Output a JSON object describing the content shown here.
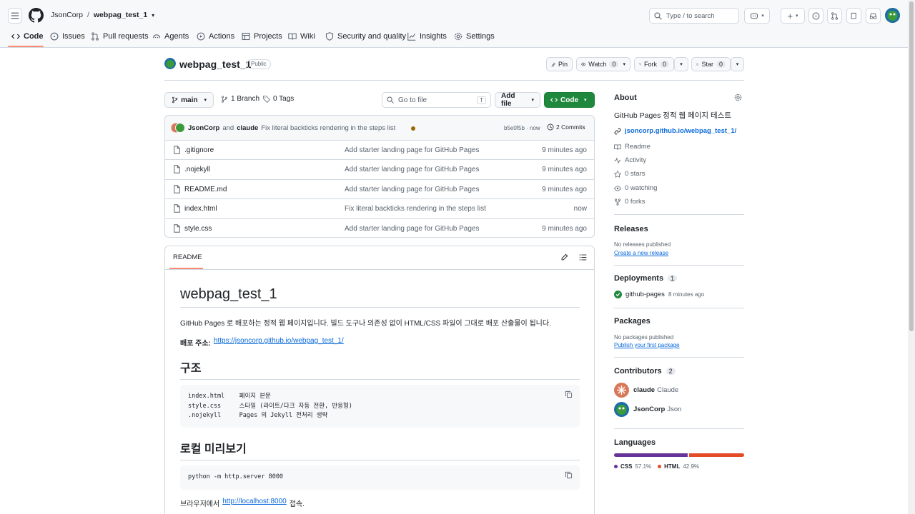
{
  "header": {
    "owner": "JsonCorp",
    "separator": "/",
    "repo": "webpag_test_1",
    "search_placeholder": "Type / to search",
    "search_key": "/"
  },
  "tabs": [
    {
      "label": "Code"
    },
    {
      "label": "Issues"
    },
    {
      "label": "Pull requests"
    },
    {
      "label": "Agents"
    },
    {
      "label": "Actions"
    },
    {
      "label": "Projects"
    },
    {
      "label": "Wiki"
    },
    {
      "label": "Security and quality"
    },
    {
      "label": "Insights"
    },
    {
      "label": "Settings"
    }
  ],
  "repo": {
    "name": "webpag_test_1",
    "visibility": "Public",
    "pin": "Pin",
    "watch": "Watch",
    "watch_count": "0",
    "fork": "Fork",
    "fork_count": "0",
    "star": "Star",
    "star_count": "0"
  },
  "toolbar": {
    "branch": "main",
    "branches": "1 Branch",
    "tags": "0 Tags",
    "goto_placeholder": "Go to file",
    "goto_key": "T",
    "add_file": "Add file",
    "code": "Code"
  },
  "commit": {
    "author1": "JsonCorp",
    "and": "and",
    "author2": "claude",
    "message": "Fix literal backticks rendering in the steps list",
    "sha": "b5e0f5b · now",
    "commits": "2 Commits"
  },
  "files": [
    {
      "name": ".gitignore",
      "msg": "Add starter landing page for GitHub Pages",
      "time": "9 minutes ago"
    },
    {
      "name": ".nojekyll",
      "msg": "Add starter landing page for GitHub Pages",
      "time": "9 minutes ago"
    },
    {
      "name": "README.md",
      "msg": "Add starter landing page for GitHub Pages",
      "time": "9 minutes ago"
    },
    {
      "name": "index.html",
      "msg": "Fix literal backticks rendering in the steps list",
      "time": "now"
    },
    {
      "name": "style.css",
      "msg": "Add starter landing page for GitHub Pages",
      "time": "9 minutes ago"
    }
  ],
  "readme": {
    "tab": "README",
    "title": "webpag_test_1",
    "intro": "GitHub Pages 로 배포하는 정적 웹 페이지입니다. 빌드 도구나 의존성 없이 HTML/CSS 파일이 그대로 배포 산출물이 됩니다.",
    "url_label": "배포 주소:",
    "url": "https://jsoncorp.github.io/webpag_test_1/",
    "h_structure": "구조",
    "code1": [
      "index.html    페이지 본문",
      "style.css     스타일 (라이트/다크 자동 전환, 반응형)",
      ".nojekyll     Pages 의 Jekyll 전처리 생략"
    ],
    "h_preview": "로컬 미리보기",
    "code2": "python -m http.server 8000",
    "browser_pre": "브라우저에서",
    "browser_link": "http://localhost:8000",
    "browser_post": "접속."
  },
  "about": {
    "title": "About",
    "desc": "GitHub Pages 정적 웹 페이지 테스트",
    "link": "jsoncorp.github.io/webpag_test_1/",
    "readme": "Readme",
    "activity": "Activity",
    "stars": "0 stars",
    "watching": "0 watching",
    "forks": "0 forks"
  },
  "releases": {
    "title": "Releases",
    "none": "No releases published",
    "create": "Create a new release"
  },
  "deployments": {
    "title": "Deployments",
    "count": "1",
    "env": "github-pages",
    "time": "8 minutes ago"
  },
  "packages": {
    "title": "Packages",
    "none": "No packages published",
    "publish": "Publish your first package"
  },
  "contributors": {
    "title": "Contributors",
    "count": "2",
    "list": [
      {
        "login": "claude",
        "name": "Claude"
      },
      {
        "login": "JsonCorp",
        "name": "Json"
      }
    ]
  },
  "languages": {
    "title": "Languages",
    "items": [
      {
        "name": "CSS",
        "percent": "57.1%",
        "value": 57.1,
        "color": "#663399"
      },
      {
        "name": "HTML",
        "percent": "42.9%",
        "value": 42.9,
        "color": "#e34c26"
      }
    ]
  },
  "colors": {
    "primary_green": "#1f883d",
    "link_blue": "#0969da",
    "accent_orange": "#fd8c73"
  }
}
